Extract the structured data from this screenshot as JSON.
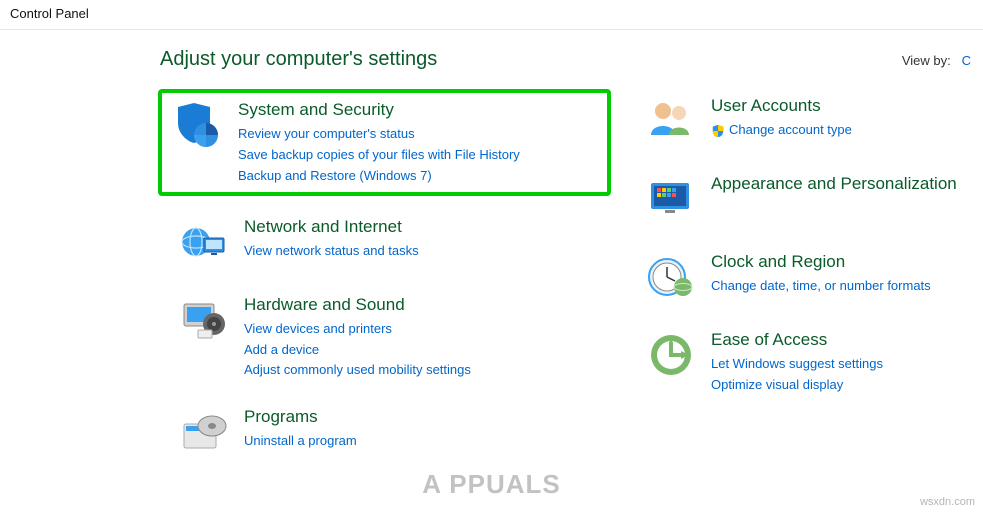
{
  "window": {
    "title": "Control Panel"
  },
  "header": {
    "title": "Adjust your computer's settings",
    "view_by_label": "View by:",
    "view_by_value": "C"
  },
  "categories_left": [
    {
      "title": "System and Security",
      "links": [
        "Review your computer's status",
        "Save backup copies of your files with File History",
        "Backup and Restore (Windows 7)"
      ]
    },
    {
      "title": "Network and Internet",
      "links": [
        "View network status and tasks"
      ]
    },
    {
      "title": "Hardware and Sound",
      "links": [
        "View devices and printers",
        "Add a device",
        "Adjust commonly used mobility settings"
      ]
    },
    {
      "title": "Programs",
      "links": [
        "Uninstall a program"
      ]
    }
  ],
  "categories_right": [
    {
      "title": "User Accounts",
      "links": [
        "Change account type"
      ],
      "shield": true
    },
    {
      "title": "Appearance and Personalization",
      "links": []
    },
    {
      "title": "Clock and Region",
      "links": [
        "Change date, time, or number formats"
      ]
    },
    {
      "title": "Ease of Access",
      "links": [
        "Let Windows suggest settings",
        "Optimize visual display"
      ]
    }
  ],
  "watermark": {
    "center": "A       PPUALS",
    "right": "wsxdn.com"
  }
}
